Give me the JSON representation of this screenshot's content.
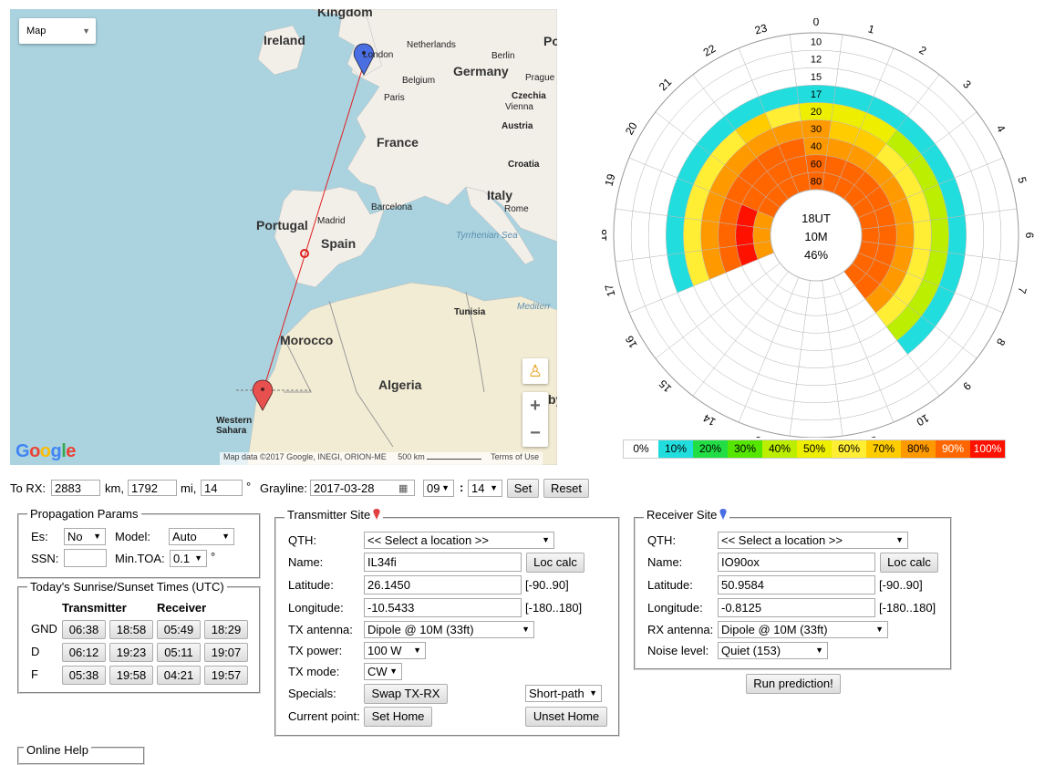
{
  "map": {
    "type_selector": "Map",
    "labels": {
      "kingdom": "Kingdom",
      "ireland": "Ireland",
      "london": "London",
      "netherlands": "Netherlands",
      "berlin": "Berlin",
      "germany": "Germany",
      "belgium": "Belgium",
      "prague": "Prague",
      "czechia": "Czechia",
      "paris": "Paris",
      "vienna": "Vienna",
      "austria": "Austria",
      "france": "France",
      "croatia": "Croatia",
      "po": "Po",
      "italy": "Italy",
      "rome": "Rome",
      "barcelona": "Barcelona",
      "portugal": "Portugal",
      "madrid": "Madrid",
      "spain": "Spain",
      "tyrrhenian": "Tyrrhenian Sea",
      "tunisia": "Tunisia",
      "mediterr": "Mediterr",
      "morocco": "Morocco",
      "algeria": "Algeria",
      "western_sahara": "Western Sahara",
      "by": "by"
    },
    "google": "Google",
    "attribution": "Map data ©2017 Google, INEGI, ORION-ME",
    "scale": "500 km",
    "terms": "Terms of Use",
    "zoom_in": "+",
    "zoom_out": "−",
    "path_color": "#e02020"
  },
  "chart_data": {
    "type": "heatmap",
    "title_lines": [
      "18UT",
      "10M",
      "46%"
    ],
    "hours": [
      "0",
      "1",
      "2",
      "3",
      "4",
      "5",
      "6",
      "7",
      "8",
      "9",
      "10",
      "11",
      "12",
      "13",
      "14",
      "15",
      "16",
      "17",
      "18",
      "19",
      "20",
      "21",
      "22",
      "23"
    ],
    "elevation_rings": [
      "10",
      "12",
      "15",
      "17",
      "20",
      "30",
      "40",
      "60",
      "80"
    ],
    "legend": [
      {
        "label": "0%",
        "color": "#ffffff"
      },
      {
        "label": "10%",
        "color": "#22dddd"
      },
      {
        "label": "20%",
        "color": "#22dd44"
      },
      {
        "label": "30%",
        "color": "#55e600"
      },
      {
        "label": "40%",
        "color": "#bbee00"
      },
      {
        "label": "50%",
        "color": "#eeee00"
      },
      {
        "label": "60%",
        "color": "#ffee33"
      },
      {
        "label": "70%",
        "color": "#ffcc00"
      },
      {
        "label": "80%",
        "color": "#ff9900"
      },
      {
        "label": "90%",
        "color": "#ff6600"
      },
      {
        "label": "100%",
        "color": "#ff1100"
      }
    ],
    "cells": [
      [
        0,
        0,
        0,
        0,
        0,
        0,
        0,
        0,
        0,
        0,
        0,
        0,
        0,
        0,
        0,
        0,
        0
      ],
      [
        0,
        0,
        0,
        0,
        0,
        0,
        0,
        0,
        0,
        0,
        0,
        0,
        0,
        0,
        0,
        0,
        0
      ],
      [
        0,
        0,
        0,
        0,
        0,
        0,
        0,
        0,
        0,
        0,
        0,
        0,
        0,
        0,
        0,
        0,
        0
      ],
      [
        1,
        1,
        1,
        1,
        1,
        1,
        1,
        1,
        1,
        1,
        1,
        1,
        1,
        1,
        1,
        1,
        1
      ],
      [
        6,
        6,
        6,
        6,
        6,
        7,
        6,
        5,
        5,
        5,
        4,
        4,
        4,
        4,
        4,
        4,
        4
      ],
      [
        8,
        8,
        8,
        8,
        8,
        8,
        8,
        8,
        7,
        7,
        6,
        6,
        6,
        6,
        6,
        6,
        6
      ],
      [
        9,
        9,
        9,
        9,
        9,
        9,
        9,
        8,
        8,
        8,
        8,
        8,
        8,
        8,
        8,
        8,
        8
      ],
      [
        10,
        10,
        10,
        9,
        9,
        9,
        9,
        9,
        9,
        9,
        9,
        9,
        9,
        9,
        9,
        9,
        9
      ],
      [
        8,
        8,
        8,
        9,
        9,
        9,
        9,
        9,
        9,
        9,
        9,
        9,
        9,
        9,
        9,
        9,
        9
      ]
    ]
  },
  "controls": {
    "to_rx_label": "To RX:",
    "km_value": "2883",
    "km_label": "km,",
    "mi_value": "1792",
    "mi_label": "mi,",
    "deg_value": "14",
    "deg_label": "°",
    "grayline_label": "Grayline:",
    "date_value": "2017-03-28",
    "hour_value": "09",
    "colon": ":",
    "minute_value": "14",
    "set_button": "Set",
    "reset_button": "Reset"
  },
  "propagation": {
    "legend": "Propagation Params",
    "es_label": "Es:",
    "es_value": "No",
    "model_label": "Model:",
    "model_value": "Auto",
    "ssn_label": "SSN:",
    "ssn_value": "",
    "mintoa_label": "Min.TOA:",
    "mintoa_value": "0.1",
    "mintoa_unit": "°"
  },
  "sun": {
    "legend": "Today's Sunrise/Sunset Times (UTC)",
    "col_tx": "Transmitter",
    "col_rx": "Receiver",
    "rows": [
      {
        "label": "GND",
        "tx_rise": "06:38",
        "tx_set": "18:58",
        "rx_rise": "05:49",
        "rx_set": "18:29"
      },
      {
        "label": "D",
        "tx_rise": "06:12",
        "tx_set": "19:23",
        "rx_rise": "05:11",
        "rx_set": "19:07"
      },
      {
        "label": "F",
        "tx_rise": "05:38",
        "tx_set": "19:58",
        "rx_rise": "04:21",
        "rx_set": "19:57"
      }
    ]
  },
  "tx": {
    "legend": "Transmitter Site",
    "qth_label": "QTH:",
    "qth_value": "<< Select a location >>",
    "name_label": "Name:",
    "name_value": "IL34fi",
    "loc_calc": "Loc calc",
    "lat_label": "Latitude:",
    "lat_value": "26.1450",
    "lat_range": "[-90..90]",
    "lon_label": "Longitude:",
    "lon_value": "-10.5433",
    "lon_range": "[-180..180]",
    "ant_label": "TX antenna:",
    "ant_value": "Dipole @ 10M (33ft)",
    "power_label": "TX power:",
    "power_value": "100 W",
    "mode_label": "TX mode:",
    "mode_value": "CW",
    "specials_label": "Specials:",
    "swap_button": "Swap TX-RX",
    "path_value": "Short-path",
    "current_label": "Current point:",
    "set_home": "Set Home",
    "unset_home": "Unset Home"
  },
  "rx": {
    "legend": "Receiver Site",
    "qth_label": "QTH:",
    "qth_value": "<< Select a location >>",
    "name_label": "Name:",
    "name_value": "IO90ox",
    "loc_calc": "Loc calc",
    "lat_label": "Latitude:",
    "lat_value": "50.9584",
    "lat_range": "[-90..90]",
    "lon_label": "Longitude:",
    "lon_value": "-0.8125",
    "lon_range": "[-180..180]",
    "ant_label": "RX antenna:",
    "ant_value": "Dipole @ 10M (33ft)",
    "noise_label": "Noise level:",
    "noise_value": "Quiet (153)"
  },
  "run_button": "Run prediction!",
  "bottom_partial": "Online Help"
}
